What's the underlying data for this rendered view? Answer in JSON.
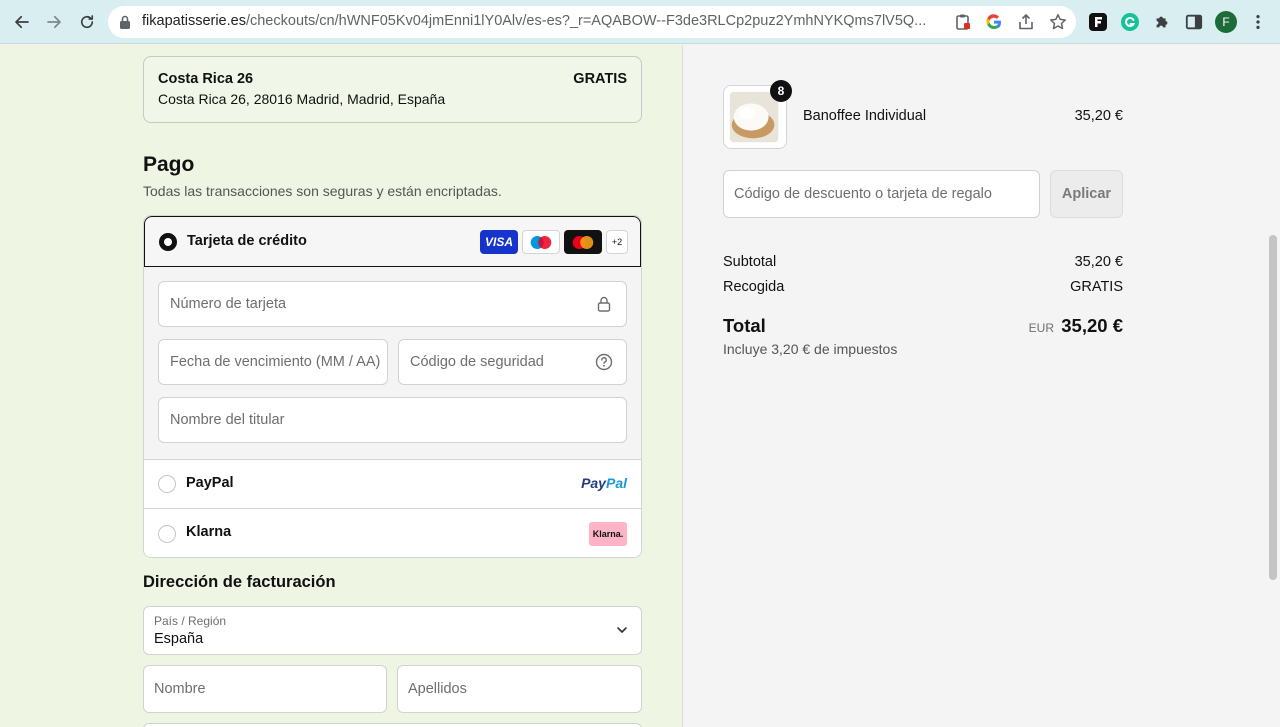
{
  "browser": {
    "url_host": "fikapatisserie.es",
    "url_path": "/checkouts/cn/hWNF05Kv04jmEnni1lY0Alv/es-es?_r=AQABOW--F3de3RLCp2puz2YmhNYKQms7lV5Q...",
    "profile_initial": "F"
  },
  "shipping": {
    "name": "Costa Rica 26",
    "address": "Costa Rica 26, 28016 Madrid, Madrid, España",
    "price": "GRATIS"
  },
  "payment": {
    "title": "Pago",
    "subtitle": "Todas las transacciones son seguras y están encriptadas.",
    "credit_card": {
      "label": "Tarjeta de crédito",
      "badges": {
        "visa": "VISA",
        "more": "+2"
      },
      "fields": {
        "number": "Número de tarjeta",
        "expiry": "Fecha de vencimiento (MM / AA)",
        "security": "Código de seguridad",
        "holder": "Nombre del titular"
      }
    },
    "paypal": {
      "label": "PayPal",
      "logo_pay": "Pay",
      "logo_pal": "Pal"
    },
    "klarna": {
      "label": "Klarna",
      "logo": "Klarna."
    }
  },
  "billing": {
    "title": "Dirección de facturación",
    "country_label": "País / Región",
    "country_value": "España",
    "first_name": "Nombre",
    "last_name": "Apellidos"
  },
  "order": {
    "product": {
      "name": "Banoffee Individual",
      "price": "35,20 €",
      "quantity": "8"
    },
    "discount_placeholder": "Código de descuento o tarjeta de regalo",
    "apply_label": "Aplicar",
    "subtotal_label": "Subtotal",
    "subtotal_value": "35,20 €",
    "pickup_label": "Recogida",
    "pickup_value": "GRATIS",
    "total_label": "Total",
    "total_currency": "EUR",
    "total_value": "35,20 €",
    "tax_note": "Incluye 3,20 € de impuestos"
  },
  "colors": {
    "left_bg": "#eef6e3",
    "right_bg": "#f4f4f4",
    "chrome_bg": "#d9eef0",
    "visa_blue": "#1434cb",
    "paypal_dark": "#253b80",
    "paypal_light": "#179bd7",
    "klarna_pink": "#ffb3c7",
    "profile_green": "#1e6b3a"
  }
}
